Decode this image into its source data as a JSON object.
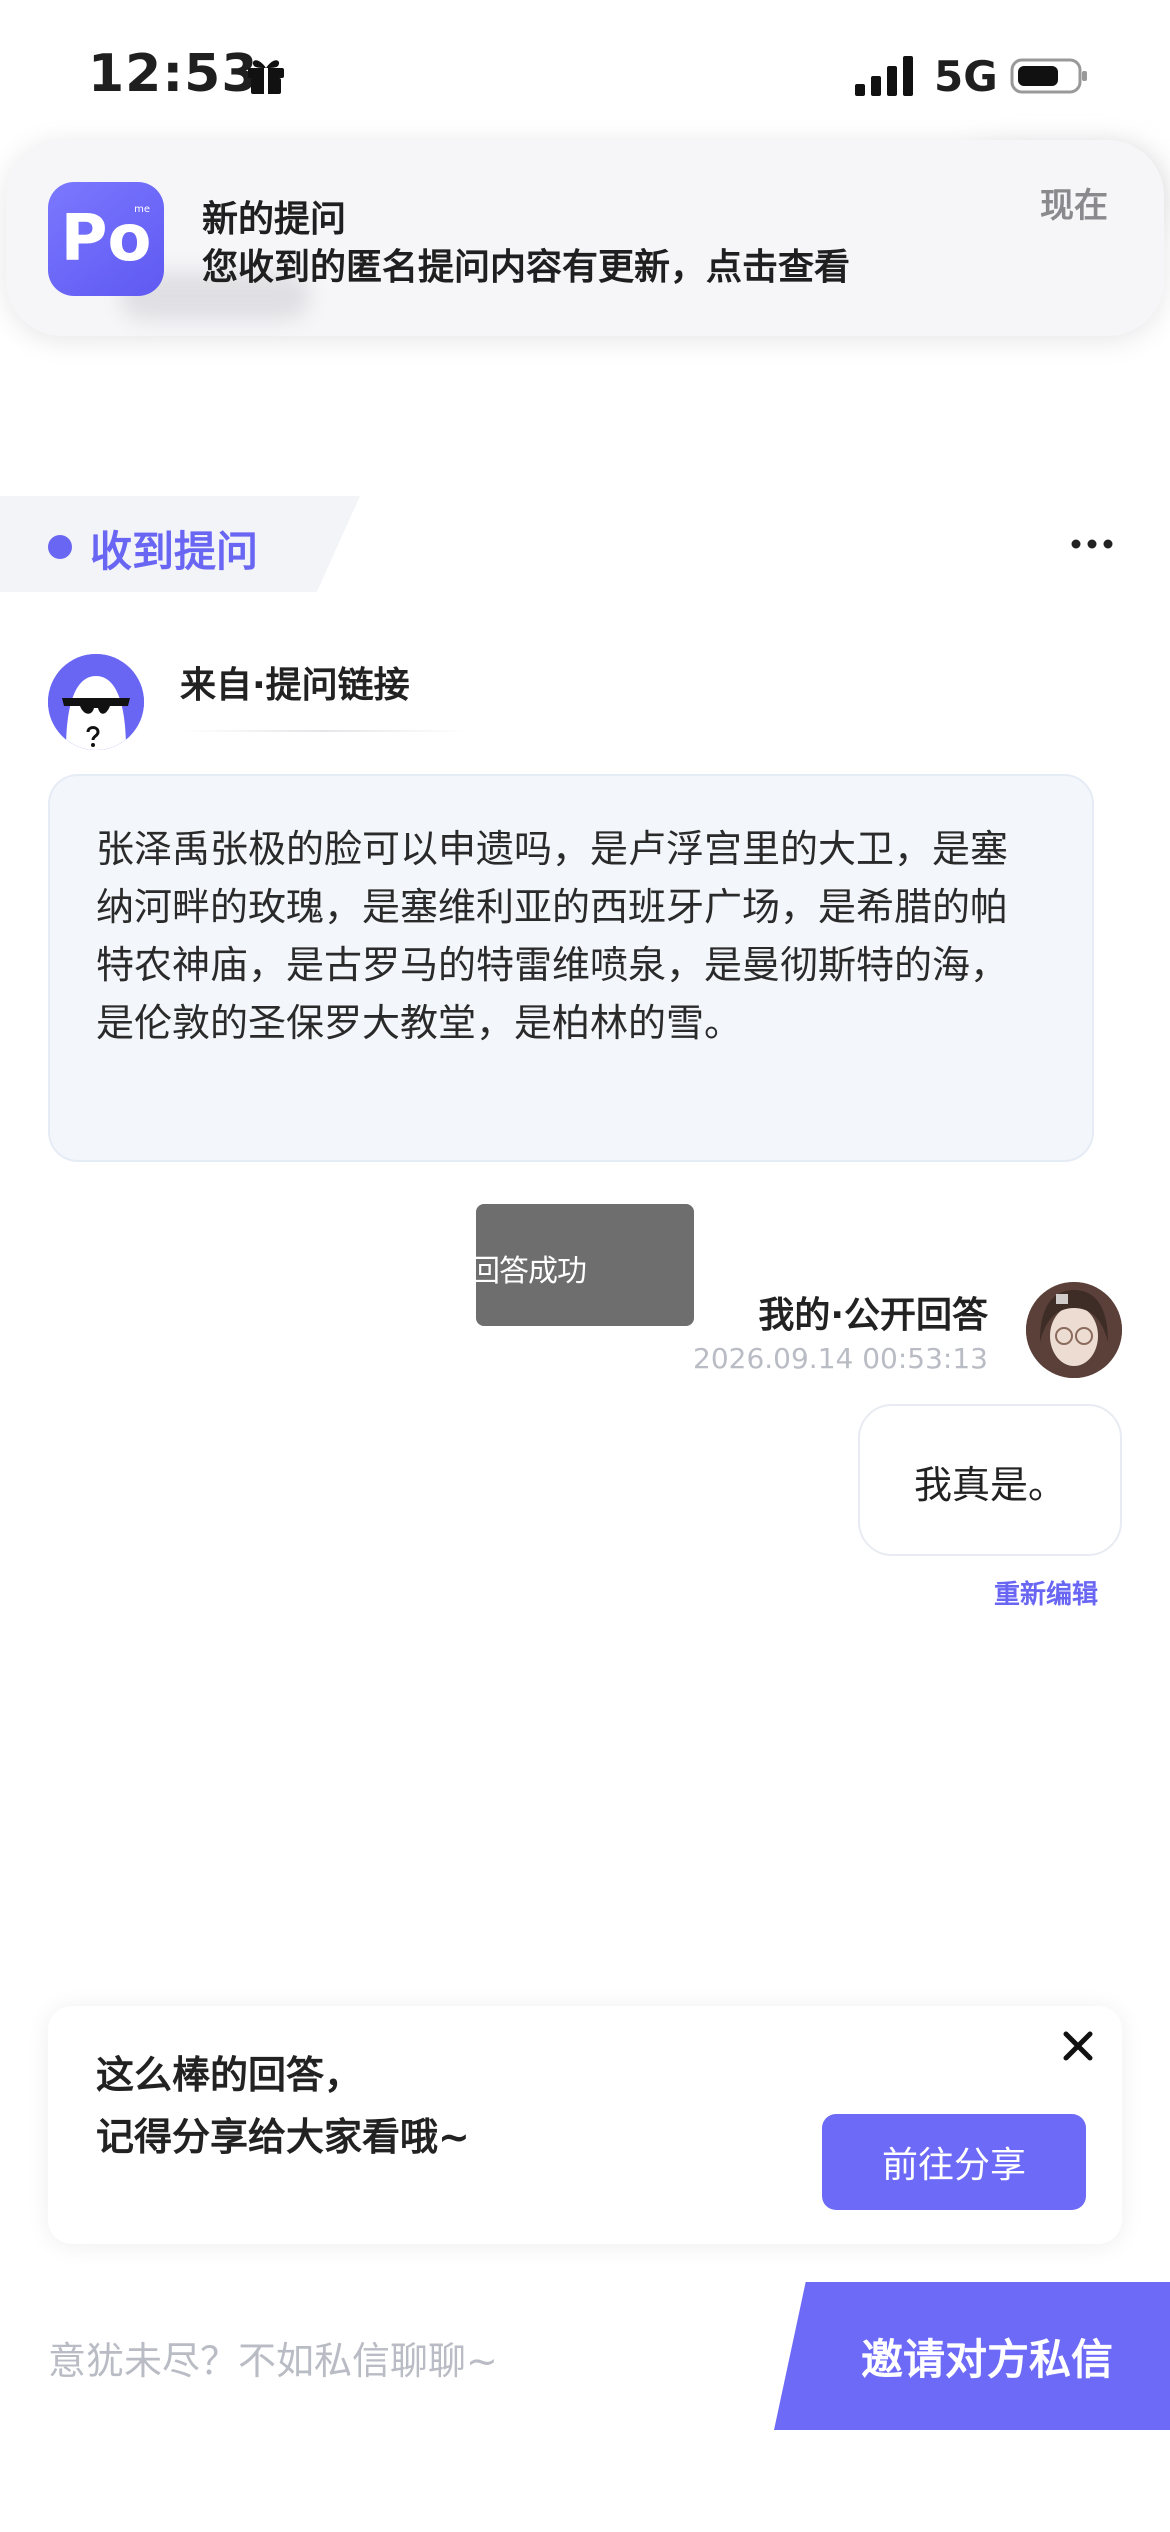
{
  "status_bar": {
    "time": "12:53",
    "network": "5G",
    "icons": [
      "gift-icon",
      "signal-icon",
      "battery-icon"
    ]
  },
  "notification": {
    "app_icon_text": "Po",
    "app_icon_superscript": "me",
    "title": "新的提问",
    "body": "您收到的匿名提问内容有更新，点击查看",
    "time": "现在"
  },
  "header": {
    "tab_label": "收到提问",
    "more_icon": "more-icon"
  },
  "question": {
    "source": "来自·提问链接",
    "text": "张泽禹张极的脸可以申遗吗，是卢浮宫里的大卫，是塞纳河畔的玫瑰，是塞维利亚的西班牙广场，是希腊的帕特农神庙，是古罗马的特雷维喷泉，是曼彻斯特的海，是伦敦的圣保罗大教堂，是柏林的雪。"
  },
  "toast": {
    "text": "回答成功"
  },
  "answer": {
    "label": "我的·公开回答",
    "timestamp": "2026.09.14 00:53:13",
    "text": "我真是。",
    "re_edit": "重新编辑"
  },
  "share_card": {
    "line1": "这么棒的回答，",
    "line2": "记得分享给大家看哦~",
    "button": "前往分享"
  },
  "bottom_bar": {
    "placeholder": "意犹未尽？不如私信聊聊~",
    "invite_button": "邀请对方私信"
  },
  "colors": {
    "accent": "#6a66f4",
    "button": "#6d6af7",
    "question_bg": "#f3f6fb",
    "muted_text": "#b9bcc4"
  }
}
